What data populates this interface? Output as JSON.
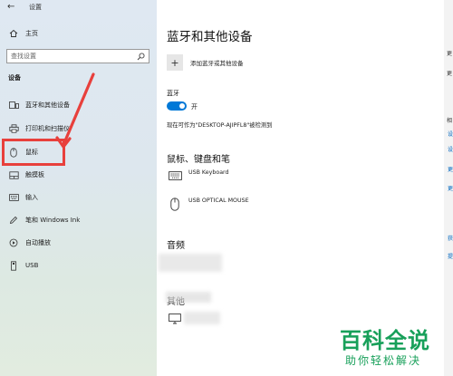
{
  "window": {
    "title": "设置"
  },
  "sidebar": {
    "home_label": "主页",
    "search_placeholder": "查找设置",
    "section_heading": "设备",
    "items": [
      {
        "label": "蓝牙和其他设备",
        "icon": "bluetooth-devices-icon"
      },
      {
        "label": "打印机和扫描仪",
        "icon": "printer-icon"
      },
      {
        "label": "鼠标",
        "icon": "mouse-icon"
      },
      {
        "label": "触摸板",
        "icon": "touchpad-icon"
      },
      {
        "label": "输入",
        "icon": "keyboard-icon"
      },
      {
        "label": "笔和 Windows Ink",
        "icon": "pen-icon"
      },
      {
        "label": "自动播放",
        "icon": "autoplay-icon"
      },
      {
        "label": "USB",
        "icon": "usb-icon"
      }
    ]
  },
  "main": {
    "page_title": "蓝牙和其他设备",
    "add_device_label": "添加蓝牙或其他设备",
    "bluetooth": {
      "label": "蓝牙",
      "state": "开",
      "discoverable_text": "现在可作为\"DESKTOP-AJIPFL8\"被检测到"
    },
    "mouse_keyboard_pen": {
      "title": "鼠标、键盘和笔",
      "devices": [
        {
          "name": "USB Keyboard",
          "icon": "keyboard-icon"
        },
        {
          "name": "USB OPTICAL MOUSE",
          "icon": "mouse-icon"
        }
      ]
    },
    "audio": {
      "title": "音频"
    },
    "other": {
      "title": "其他"
    }
  },
  "right_panel": {
    "fragments": [
      "更",
      "更",
      "相",
      "设",
      "设",
      "更",
      "更",
      "获",
      "提"
    ]
  },
  "watermark": {
    "main": "百科全说",
    "sub": "助你轻松解决"
  },
  "colors": {
    "accent": "#0078d7",
    "highlight": "#e8403c",
    "watermark": "#18a05a"
  }
}
